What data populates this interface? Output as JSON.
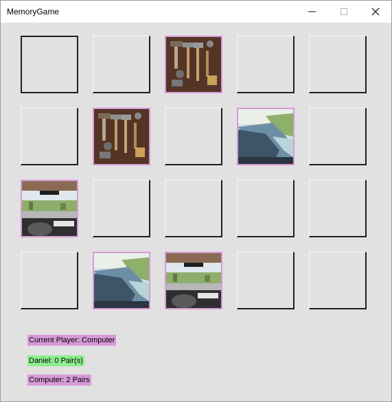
{
  "window": {
    "title": "MemoryGame"
  },
  "titlebar_buttons": {
    "minimize": "minimize-icon",
    "maximize": "maximize-icon",
    "close": "close-icon"
  },
  "board": {
    "rows": 4,
    "cols": 5,
    "tiles": [
      {
        "state": "selected"
      },
      {
        "state": "hidden"
      },
      {
        "state": "revealed",
        "image": "tools"
      },
      {
        "state": "hidden"
      },
      {
        "state": "hidden"
      },
      {
        "state": "hidden"
      },
      {
        "state": "revealed",
        "image": "tools"
      },
      {
        "state": "hidden"
      },
      {
        "state": "revealed",
        "image": "canyon"
      },
      {
        "state": "hidden"
      },
      {
        "state": "revealed",
        "image": "car"
      },
      {
        "state": "hidden"
      },
      {
        "state": "hidden"
      },
      {
        "state": "hidden"
      },
      {
        "state": "hidden"
      },
      {
        "state": "hidden"
      },
      {
        "state": "revealed",
        "image": "canyon"
      },
      {
        "state": "revealed",
        "image": "car"
      },
      {
        "state": "hidden"
      },
      {
        "state": "hidden"
      }
    ]
  },
  "status": {
    "current_player": "Current Player: Computer",
    "player1_score": "Daniel: 0 Pair(s)",
    "player2_score": "Computer: 2 Pairs"
  },
  "colors": {
    "highlight_pink": "#d79ad8",
    "highlight_green": "#90ee90",
    "background": "#e1e1e1"
  }
}
